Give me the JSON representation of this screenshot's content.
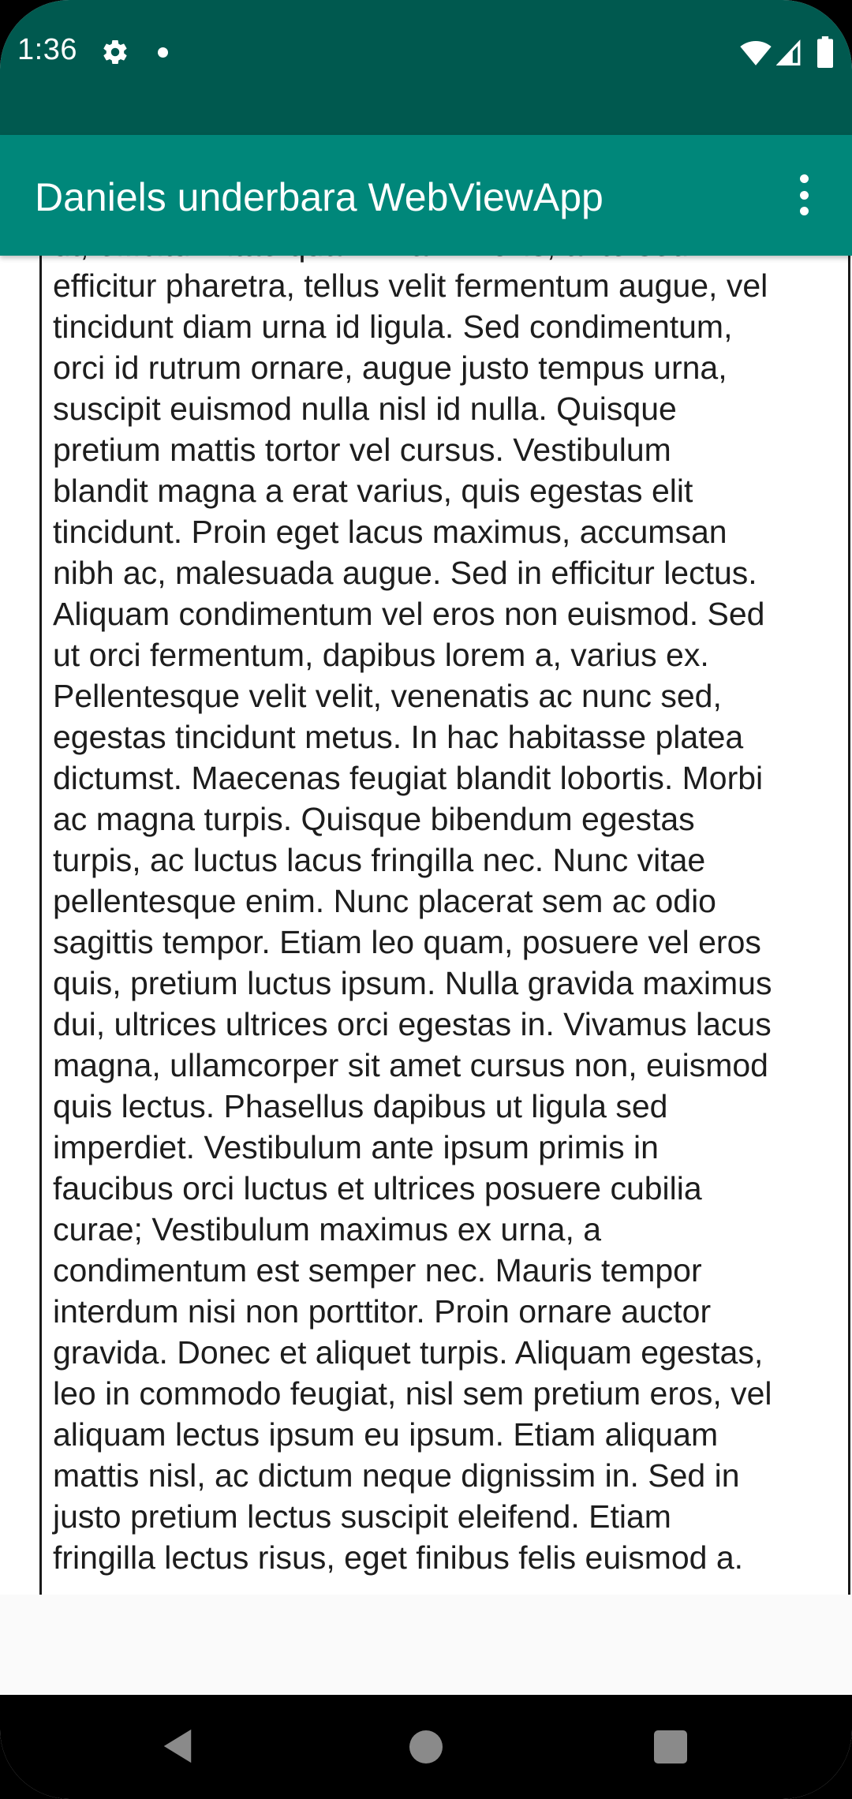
{
  "status_bar": {
    "time": "1:36",
    "icons": [
      "settings-gear-icon",
      "notification-dot-icon",
      "wifi-icon",
      "cell-signal-icon",
      "battery-icon"
    ]
  },
  "app_bar": {
    "title": "Daniels underbara WebViewApp",
    "menu_icon": "overflow-menu-icon"
  },
  "webview": {
    "lines": [
      "ut, efficitur vitae quam. Nam mollis, ante sed",
      "efficitur pharetra, tellus velit fermentum augue, vel",
      "tincidunt diam urna id ligula. Sed condimentum,",
      "orci id rutrum ornare, augue justo tempus urna,",
      "suscipit euismod nulla nisl id nulla. Quisque",
      "pretium mattis tortor vel cursus. Vestibulum",
      "blandit magna a erat varius, quis egestas elit",
      "tincidunt. Proin eget lacus maximus, accumsan",
      "nibh ac, malesuada augue. Sed in efficitur lectus.",
      "Aliquam condimentum vel eros non euismod. Sed",
      "ut orci fermentum, dapibus lorem a, varius ex.",
      "Pellentesque velit velit, venenatis ac nunc sed,",
      "egestas tincidunt metus. In hac habitasse platea",
      "dictumst. Maecenas feugiat blandit lobortis. Morbi",
      "ac magna turpis. Quisque bibendum egestas",
      "turpis, ac luctus lacus fringilla nec. Nunc vitae",
      "pellentesque enim. Nunc placerat sem ac odio",
      "sagittis tempor. Etiam leo quam, posuere vel eros",
      "quis, pretium luctus ipsum. Nulla gravida maximus",
      "dui, ultrices ultrices orci egestas in. Vivamus lacus",
      "magna, ullamcorper sit amet cursus non, euismod",
      "quis lectus. Phasellus dapibus ut ligula sed",
      "imperdiet. Vestibulum ante ipsum primis in",
      "faucibus orci luctus et ultrices posuere cubilia",
      "curae; Vestibulum maximus ex urna, a",
      "condimentum est semper nec. Mauris tempor",
      "interdum nisi non porttitor. Proin ornare auctor",
      "gravida. Donec et aliquet turpis. Aliquam egestas,",
      "leo in commodo feugiat, nisl sem pretium eros, vel",
      "aliquam lectus ipsum eu ipsum. Etiam aliquam",
      "mattis nisl, ac dictum neque dignissim in. Sed in",
      "justo pretium lectus suscipit eleifend. Etiam",
      "fringilla lectus risus, eget finibus felis euismod a."
    ]
  },
  "nav_bar": {
    "icons": [
      "back-icon",
      "home-icon",
      "recents-icon"
    ]
  },
  "colors": {
    "status_bar": "#00594f",
    "app_bar": "#00877a",
    "text": "#1d1d1d",
    "nav_bar": "#000000"
  }
}
